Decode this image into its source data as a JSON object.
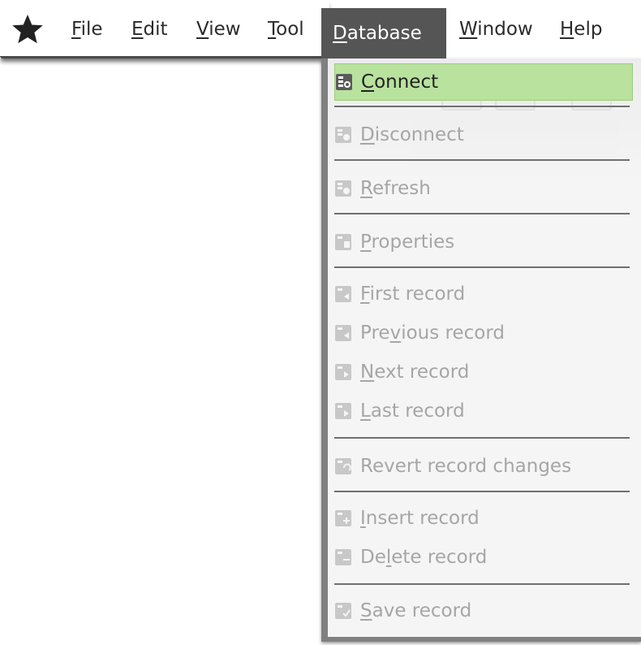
{
  "menubar": {
    "app_icon": "star-icon",
    "menus": [
      {
        "label": "File",
        "mnemonic": "F",
        "rest": "ile"
      },
      {
        "label": "Edit",
        "mnemonic": "E",
        "rest": "dit"
      },
      {
        "label": "View",
        "mnemonic": "V",
        "rest": "iew"
      },
      {
        "label": "Tool",
        "mnemonic": "T",
        "rest": "ool"
      },
      {
        "label": "Database",
        "mnemonic": "D",
        "rest": "atabase"
      },
      {
        "label": "Window",
        "mnemonic": "W",
        "rest": "indow"
      },
      {
        "label": "Help",
        "mnemonic": "H",
        "rest": "elp"
      }
    ],
    "active_menu": "Database"
  },
  "database_menu": {
    "items": [
      {
        "label": "Connect",
        "pre": "",
        "mn": "C",
        "post": "onnect",
        "enabled": true,
        "icon": "connect-icon"
      },
      {
        "label": "Disconnect",
        "pre": "",
        "mn": "D",
        "post": "isconnect",
        "enabled": false,
        "icon": "disconnect-icon"
      },
      {
        "label": "Refresh",
        "pre": "",
        "mn": "R",
        "post": "efresh",
        "enabled": false,
        "icon": "refresh-icon"
      },
      {
        "label": "Properties",
        "pre": "",
        "mn": "P",
        "post": "roperties",
        "enabled": false,
        "icon": "properties-icon"
      },
      {
        "label": "First record",
        "pre": "",
        "mn": "F",
        "post": "irst record",
        "enabled": false,
        "icon": "first-record-icon"
      },
      {
        "label": "Previous record",
        "pre": "Pre",
        "mn": "v",
        "post": "ious record",
        "enabled": false,
        "icon": "previous-record-icon"
      },
      {
        "label": "Next record",
        "pre": "",
        "mn": "N",
        "post": "ext record",
        "enabled": false,
        "icon": "next-record-icon"
      },
      {
        "label": "Last record",
        "pre": "",
        "mn": "L",
        "post": "ast record",
        "enabled": false,
        "icon": "last-record-icon"
      },
      {
        "label": "Revert record changes",
        "pre": "Revert record changes",
        "mn": "",
        "post": "",
        "enabled": false,
        "icon": "revert-record-icon"
      },
      {
        "label": "Insert record",
        "pre": "",
        "mn": "I",
        "post": "nsert record",
        "enabled": false,
        "icon": "insert-record-icon"
      },
      {
        "label": "Delete record",
        "pre": "De",
        "mn": "l",
        "post": "ete record",
        "enabled": false,
        "icon": "delete-record-icon"
      },
      {
        "label": "Save record",
        "pre": "",
        "mn": "S",
        "post": "ave record",
        "enabled": false,
        "icon": "save-record-icon"
      }
    ]
  },
  "colors": {
    "active_menu_bg": "#555555",
    "highlight_bg": "#b8e29e",
    "disabled_text": "#a6a6a6",
    "separator": "#6f6f6f"
  }
}
